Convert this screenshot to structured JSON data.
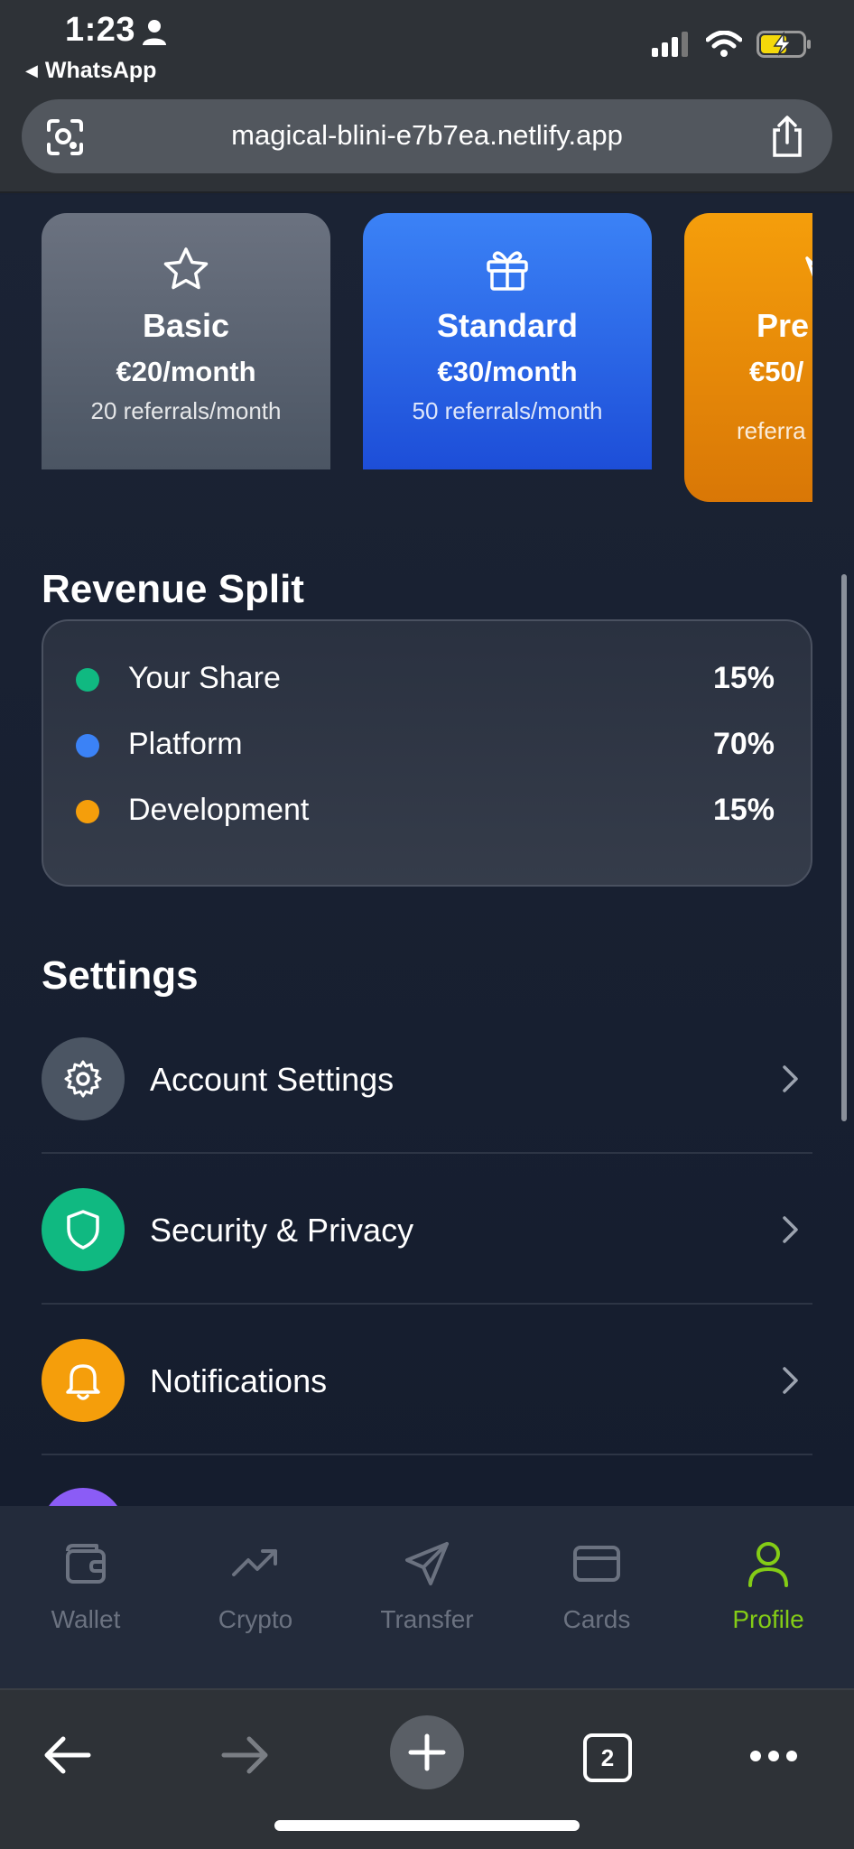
{
  "status_bar": {
    "time": "1:23",
    "back_app": "WhatsApp"
  },
  "browser": {
    "url": "magical-blini-e7b7ea.netlify.app",
    "tab_count": "2"
  },
  "plans": [
    {
      "name": "Basic",
      "price": "€20/month",
      "referrals": "20 referrals/month",
      "icon": "star-icon",
      "color": "#6b7280"
    },
    {
      "name": "Standard",
      "price": "€30/month",
      "referrals": "50 referrals/month",
      "icon": "gift-icon",
      "color": "#2563eb"
    },
    {
      "name": "Pre",
      "price": "€50/",
      "referrals": "referra",
      "icon": "crown-icon",
      "color": "#f59e0b"
    }
  ],
  "revenue_split": {
    "title": "Revenue Split",
    "items": [
      {
        "label": "Your Share",
        "value": "15%",
        "color": "#10b981"
      },
      {
        "label": "Platform",
        "value": "70%",
        "color": "#3b82f6"
      },
      {
        "label": "Development",
        "value": "15%",
        "color": "#f59e0b"
      }
    ]
  },
  "settings": {
    "title": "Settings",
    "items": [
      {
        "label": "Account Settings",
        "icon": "gear-icon",
        "color": "#4b5563"
      },
      {
        "label": "Security & Privacy",
        "icon": "shield-icon",
        "color": "#10b981"
      },
      {
        "label": "Notifications",
        "icon": "bell-icon",
        "color": "#f59e0b"
      }
    ]
  },
  "tabbar": {
    "items": [
      {
        "label": "Wallet",
        "icon": "wallet-icon",
        "active": false
      },
      {
        "label": "Crypto",
        "icon": "trending-up-icon",
        "active": false
      },
      {
        "label": "Transfer",
        "icon": "send-icon",
        "active": false
      },
      {
        "label": "Cards",
        "icon": "card-icon",
        "active": false
      },
      {
        "label": "Profile",
        "icon": "user-icon",
        "active": true
      }
    ],
    "active_color": "#84cc16"
  }
}
